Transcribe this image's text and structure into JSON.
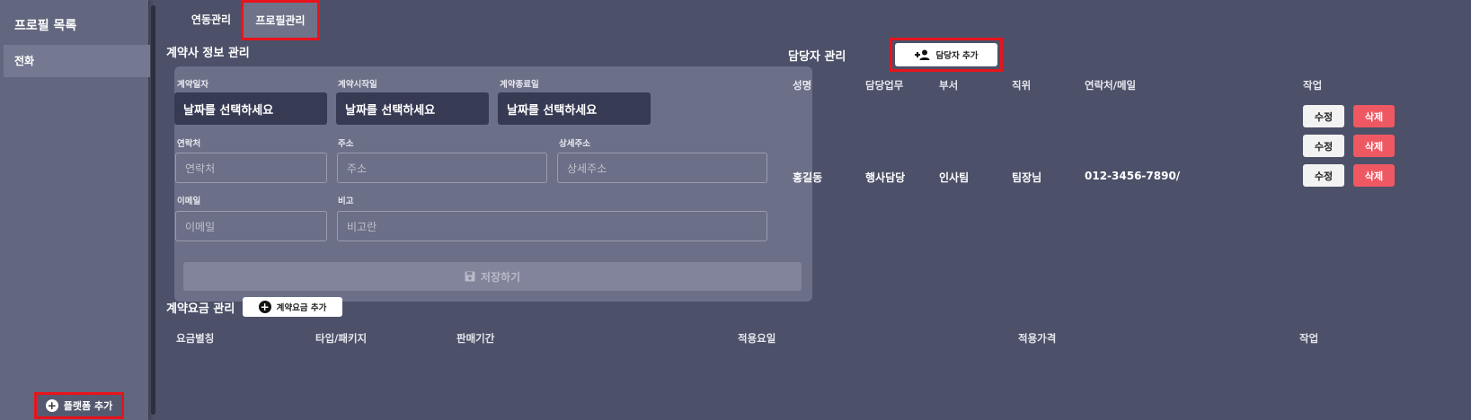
{
  "sidebar": {
    "title": "프로필 목록",
    "items": [
      {
        "label": "전화"
      }
    ],
    "add_label": "플랫폼 추가"
  },
  "tabs": [
    {
      "label": "연동관리",
      "active": false
    },
    {
      "label": "프로필관리",
      "active": true
    }
  ],
  "contract": {
    "title": "계약사 정보 관리",
    "labels": {
      "contract_date": "계약일자",
      "start_date": "계약시작일",
      "end_date": "계약종료일",
      "phone": "연락처",
      "address": "주소",
      "address_detail": "상세주소",
      "email": "이메일",
      "note": "비고"
    },
    "date_placeholder": "날짜를 선택하세요",
    "placeholders": {
      "phone": "연락처",
      "address": "주소",
      "address_detail": "상세주소",
      "email": "이메일",
      "note": "비고란"
    },
    "save_label": "저장하기"
  },
  "managers": {
    "title": "담당자 관리",
    "add_label": "담당자 추가",
    "columns": [
      "성명",
      "담당업무",
      "부서",
      "직위",
      "연락처/메일",
      "작업"
    ],
    "rows": [
      {
        "name": "",
        "duty": "",
        "dept": "",
        "position": "",
        "contact": ""
      },
      {
        "name": "",
        "duty": "",
        "dept": "",
        "position": "",
        "contact": ""
      },
      {
        "name": "홍길동",
        "duty": "행사담당",
        "dept": "인사팀",
        "position": "팀장님",
        "contact": "012-3456-7890/"
      }
    ],
    "edit_label": "수정",
    "delete_label": "삭제"
  },
  "fees": {
    "title": "계약요금 관리",
    "add_label": "계약요금 추가",
    "columns": [
      "요금별칭",
      "타입/패키지",
      "판매기간",
      "적용요일",
      "적용가격",
      "작업"
    ]
  },
  "colors": {
    "background": "#4c5068",
    "highlight": "#e8131b",
    "delete": "#ee5863"
  }
}
